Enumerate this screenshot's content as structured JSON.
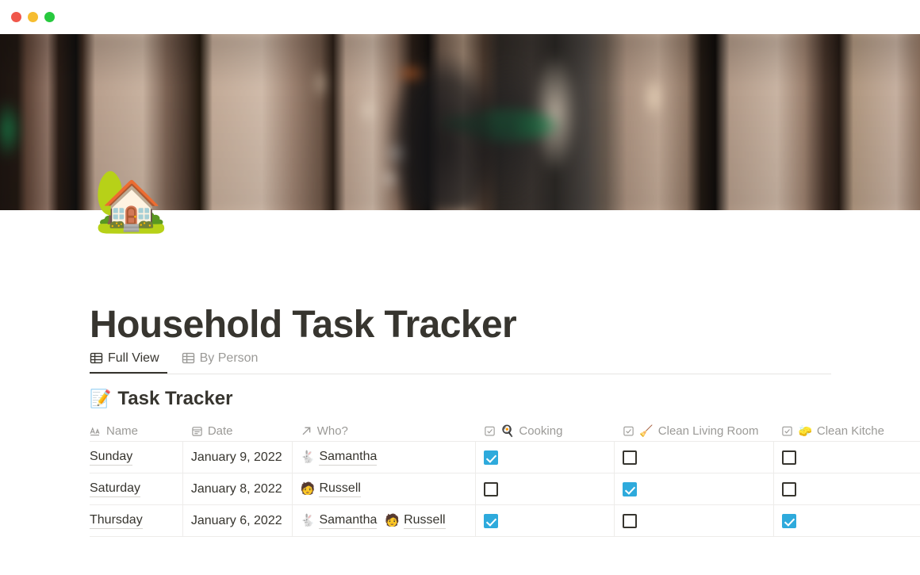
{
  "window": {
    "traffic_lights": [
      {
        "name": "close",
        "color": "#f0574b"
      },
      {
        "name": "minimize",
        "color": "#f6bd30"
      },
      {
        "name": "maximize",
        "color": "#27c93e"
      }
    ]
  },
  "page": {
    "icon": "🏡",
    "title": "Household Task Tracker"
  },
  "tabs": [
    {
      "label": "Full View",
      "icon": "table-icon",
      "active": true
    },
    {
      "label": "By Person",
      "icon": "table-icon",
      "active": false
    }
  ],
  "database": {
    "emoji": "📝",
    "title": "Task Tracker",
    "columns": [
      {
        "label": "Name",
        "icon": "text-aa-icon",
        "type": "title"
      },
      {
        "label": "Date",
        "icon": "calendar-icon",
        "type": "date"
      },
      {
        "label": "Who?",
        "icon": "relation-arrow-icon",
        "type": "relation"
      },
      {
        "label": "Cooking",
        "icon": "checkbox-icon",
        "emoji": "🍳",
        "type": "checkbox"
      },
      {
        "label": "Clean Living Room",
        "icon": "checkbox-icon",
        "emoji": "🧹",
        "type": "checkbox"
      },
      {
        "label": "Clean Kitche",
        "icon": "checkbox-icon",
        "emoji": "🧽",
        "type": "checkbox"
      }
    ],
    "rows": [
      {
        "name": "Sunday",
        "date": "January 9, 2022",
        "who": [
          {
            "emoji": "🐇",
            "name": "Samantha"
          }
        ],
        "cooking": true,
        "clean_living_room": false,
        "clean_kitchen": false
      },
      {
        "name": "Saturday",
        "date": "January 8, 2022",
        "who": [
          {
            "emoji": "🧑",
            "name": "Russell"
          }
        ],
        "cooking": false,
        "clean_living_room": true,
        "clean_kitchen": false
      },
      {
        "name": "Thursday",
        "date": "January 6, 2022",
        "who": [
          {
            "emoji": "🐇",
            "name": "Samantha"
          },
          {
            "emoji": "🧑",
            "name": "Russell"
          }
        ],
        "cooking": true,
        "clean_living_room": false,
        "clean_kitchen": true
      }
    ]
  },
  "colors": {
    "accent_checkbox": "#2eaadc",
    "text_primary": "#37352f",
    "text_muted": "#9b9a97",
    "border": "#edecea"
  }
}
